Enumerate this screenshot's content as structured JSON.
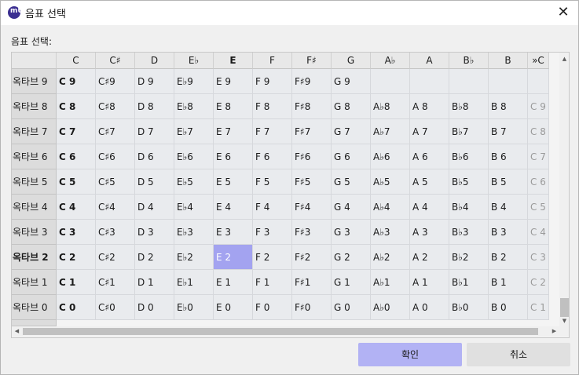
{
  "window": {
    "title": "음표 선택",
    "app_icon_text": "mU"
  },
  "caption": "음표 선택:",
  "columns": [
    "C",
    "C♯",
    "D",
    "E♭",
    "E",
    "F",
    "F♯",
    "G",
    "A♭",
    "A",
    "B♭",
    "B",
    "»C"
  ],
  "bold_column_index": 4,
  "rows": [
    {
      "label": "옥타브 9",
      "cells": [
        "C 9",
        "C♯9",
        "D 9",
        "E♭9",
        "E 9",
        "F 9",
        "F♯9",
        "G 9",
        "",
        "",
        "",
        "",
        ""
      ]
    },
    {
      "label": "옥타브 8",
      "cells": [
        "C 8",
        "C♯8",
        "D 8",
        "E♭8",
        "E 8",
        "F 8",
        "F♯8",
        "G 8",
        "A♭8",
        "A 8",
        "B♭8",
        "B 8",
        "C 9"
      ]
    },
    {
      "label": "옥타브 7",
      "cells": [
        "C 7",
        "C♯7",
        "D 7",
        "E♭7",
        "E 7",
        "F 7",
        "F♯7",
        "G 7",
        "A♭7",
        "A 7",
        "B♭7",
        "B 7",
        "C 8"
      ]
    },
    {
      "label": "옥타브 6",
      "cells": [
        "C 6",
        "C♯6",
        "D 6",
        "E♭6",
        "E 6",
        "F 6",
        "F♯6",
        "G 6",
        "A♭6",
        "A 6",
        "B♭6",
        "B 6",
        "C 7"
      ]
    },
    {
      "label": "옥타브 5",
      "cells": [
        "C 5",
        "C♯5",
        "D 5",
        "E♭5",
        "E 5",
        "F 5",
        "F♯5",
        "G 5",
        "A♭5",
        "A 5",
        "B♭5",
        "B 5",
        "C 6"
      ]
    },
    {
      "label": "옥타브 4",
      "cells": [
        "C 4",
        "C♯4",
        "D 4",
        "E♭4",
        "E 4",
        "F 4",
        "F♯4",
        "G 4",
        "A♭4",
        "A 4",
        "B♭4",
        "B 4",
        "C 5"
      ]
    },
    {
      "label": "옥타브 3",
      "cells": [
        "C 3",
        "C♯3",
        "D 3",
        "E♭3",
        "E 3",
        "F 3",
        "F♯3",
        "G 3",
        "A♭3",
        "A 3",
        "B♭3",
        "B 3",
        "C 4"
      ]
    },
    {
      "label": "옥타브 2",
      "cells": [
        "C 2",
        "C♯2",
        "D 2",
        "E♭2",
        "E 2",
        "F 2",
        "F♯2",
        "G 2",
        "A♭2",
        "A 2",
        "B♭2",
        "B 2",
        "C 3"
      ]
    },
    {
      "label": "옥타브 1",
      "cells": [
        "C 1",
        "C♯1",
        "D 1",
        "E♭1",
        "E 1",
        "F 1",
        "F♯1",
        "G 1",
        "A♭1",
        "A 1",
        "B♭1",
        "B 1",
        "C 2"
      ]
    },
    {
      "label": "옥타브 0",
      "cells": [
        "C 0",
        "C♯0",
        "D 0",
        "E♭0",
        "E 0",
        "F 0",
        "F♯0",
        "G 0",
        "A♭0",
        "A 0",
        "B♭0",
        "B 0",
        "C 1"
      ]
    }
  ],
  "bold_row_label": "옥타브 2",
  "selected_note": "E 2",
  "buttons": {
    "ok": "확인",
    "cancel": "취소"
  },
  "icons": {
    "close": "close-icon",
    "scroll_up": "arrow-up-icon",
    "scroll_down": "arrow-down-icon",
    "scroll_left": "arrow-left-icon",
    "scroll_right": "arrow-right-icon"
  },
  "colors": {
    "selected": "#a3a3f0",
    "ok_button": "#b2b2f4",
    "app_icon": "#3b2f91"
  }
}
